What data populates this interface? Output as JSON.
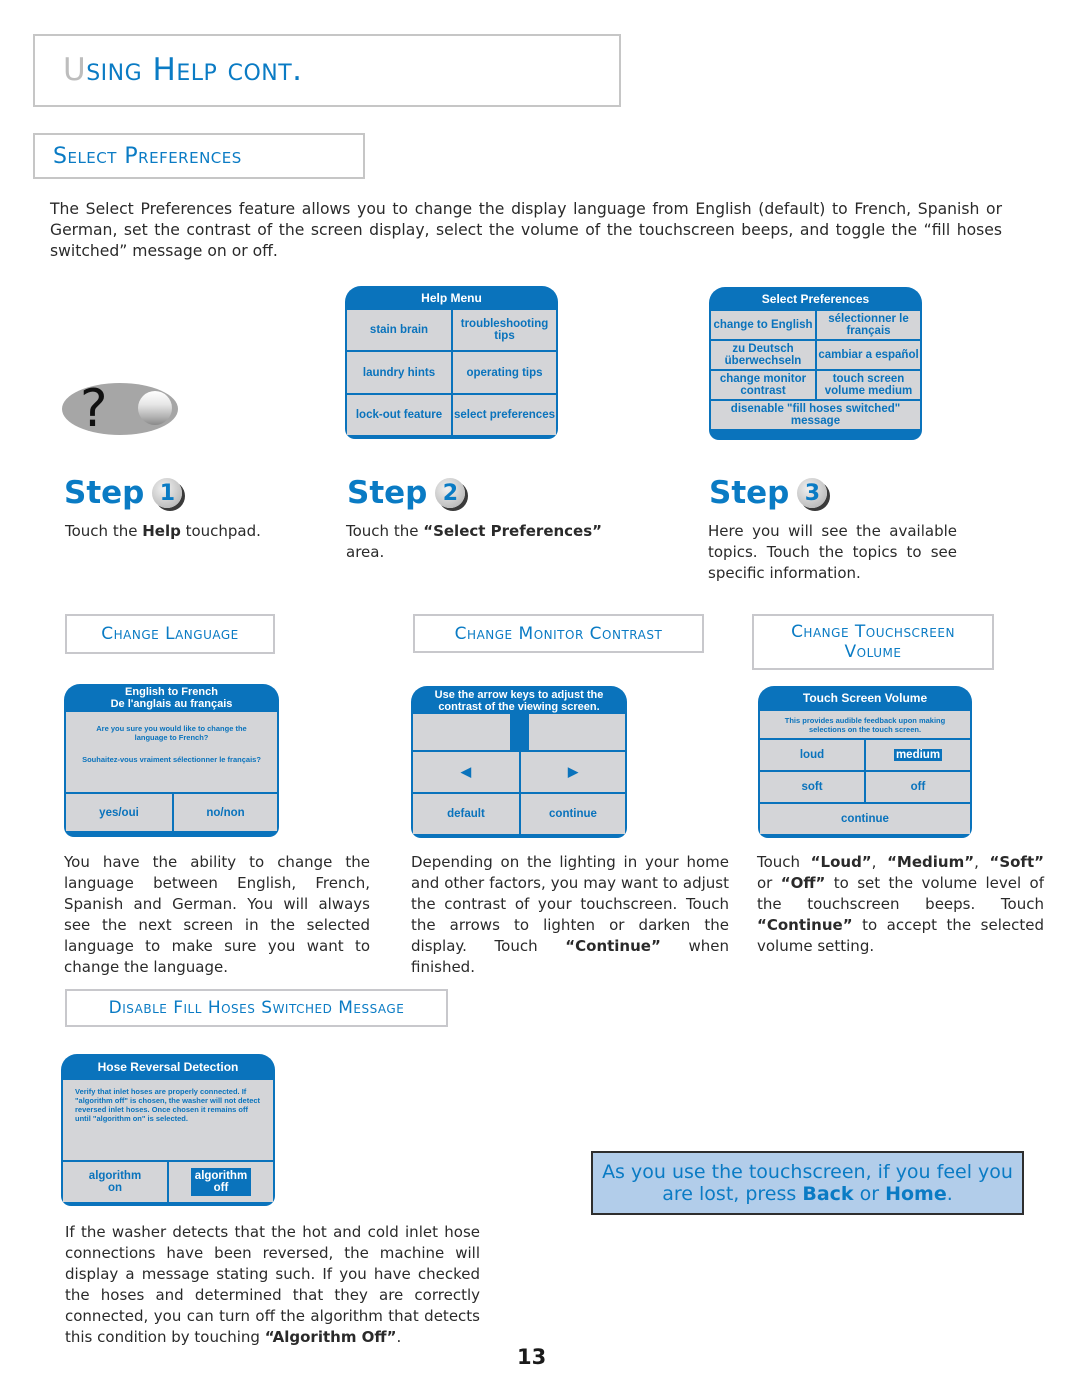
{
  "page": {
    "title_first_letter": "U",
    "title_rest": "sing Help cont.",
    "section_title": "Select Preferences",
    "intro": "The Select Preferences feature allows you to change the display language from English (default) to French, Spanish or German, set the contrast of the screen display, select the volume of the touchscreen beeps, and toggle the “fill hoses switched” message on or off.",
    "page_number": "13"
  },
  "help_icon": {
    "glyph": "?",
    "icon": "help-touchpad-icon"
  },
  "help_menu": {
    "title": "Help Menu",
    "items": [
      {
        "label": "stain brain"
      },
      {
        "label": "troubleshooting tips"
      },
      {
        "label": "laundry hints"
      },
      {
        "label": "operating tips"
      },
      {
        "label": "lock-out feature"
      },
      {
        "label": "select preferences"
      }
    ]
  },
  "select_prefs_menu": {
    "title": "Select Preferences",
    "items": [
      {
        "label": "change to English"
      },
      {
        "label": "sélectionner le français"
      },
      {
        "label": "zu Deutsch überwechseln"
      },
      {
        "label": "cambiar a español"
      },
      {
        "label": "change monitor contrast"
      },
      {
        "label": "touch screen volume medium"
      }
    ],
    "wide_item": "disenable \"fill hoses switched\" message"
  },
  "steps": [
    {
      "label": "Step",
      "number": "1",
      "text_pre": "Touch the ",
      "text_bold": "Help",
      "text_post": " touchpad."
    },
    {
      "label": "Step",
      "number": "2",
      "text_pre": "Touch the ",
      "text_bold": "“Select Preferences”",
      "text_post": " area."
    },
    {
      "label": "Step",
      "number": "3",
      "text": "Here you will see the available topics.  Touch the topics to see specific information."
    }
  ],
  "sections": {
    "change_language": {
      "title": "Change Language",
      "panel_title_1": "English to French",
      "panel_title_2": "De l'anglais au français",
      "msg_1": "Are you sure you would like to change the language to French?",
      "msg_2": "Souhaitez-vous vraiment sélectionner le français?",
      "yes": "yes/oui",
      "no": "no/non",
      "description": "You have the ability to change the language between English, French, Spanish and German.  You will always see the next screen in the selected language to make sure you want to change the language."
    },
    "change_contrast": {
      "title": "Change Monitor Contrast",
      "panel_title": "Use the arrow keys to adjust the contrast of the viewing screen.",
      "left_arrow": "◀",
      "right_arrow": "▶",
      "default": "default",
      "continue": "continue",
      "desc_pre": "Depending on the lighting in your home and other factors, you may want to adjust the contrast of your touchscreen.  Touch the arrows to lighten or darken the display.  Touch ",
      "desc_bold": "“Continue”",
      "desc_post": " when finished."
    },
    "change_volume": {
      "title_1": "Change Touchscreen",
      "title_2": "Volume",
      "panel_title": "Touch Screen Volume",
      "panel_msg": "This provides audible feedback upon making selections on the touch screen.",
      "options": [
        "loud",
        "medium",
        "soft",
        "off"
      ],
      "selected": "medium",
      "continue": "continue",
      "desc_1": "Touch ",
      "desc_loud": "“Loud”",
      "desc_sep1": ", ",
      "desc_medium": "“Medium”",
      "desc_sep2": ", ",
      "desc_soft": "“Soft”",
      "desc_or": " or ",
      "desc_off": "“Off”",
      "desc_mid": " to set the volume level of the touchscreen beeps. Touch ",
      "desc_continue": "“Continue”",
      "desc_end": " to accept the selected volume setting."
    },
    "disable_hoses": {
      "title": "Disable Fill Hoses Switched Message",
      "panel_title": "Hose Reversal Detection",
      "panel_msg": "Verify that inlet hoses are properly connected. If \"algorithm off\" is chosen, the washer will not detect reversed inlet hoses.  Once chosen it remains off until \"algorithm on\" is selected.",
      "on": "algorithm on",
      "off": "algorithm off",
      "desc_pre": "If the washer detects that the hot and cold inlet hose connections have been reversed, the machine will display a message stating such.  If you have checked the hoses and determined that they are correctly connected, you can turn off the algorithm that detects this condition by touching ",
      "desc_bold": "“Algorithm Off”",
      "desc_post": "."
    }
  },
  "tip": {
    "line_pre": "As you use the touchscreen, if you feel you are lost, press ",
    "back": "Back",
    "or": " or ",
    "home": "Home",
    "end": "."
  },
  "colors": {
    "accent_blue": "#0a7bc4",
    "panel_blue": "#0a73bc",
    "panel_gray": "#d4d5d8",
    "tip_bg": "#b2cdea"
  }
}
